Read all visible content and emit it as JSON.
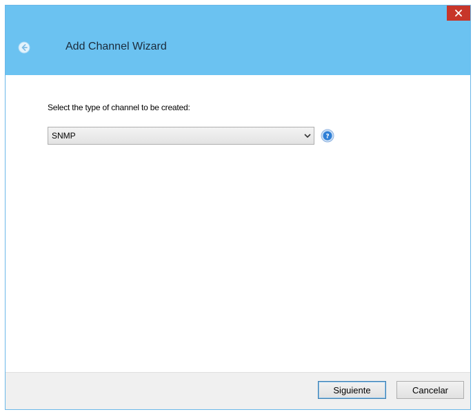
{
  "window": {
    "title": "Add Channel Wizard"
  },
  "header": {
    "close_icon": "close-icon",
    "back_icon": "back-arrow-icon"
  },
  "content": {
    "prompt": "Select the type of channel to be created:",
    "channel_type": {
      "selected": "SNMP"
    },
    "help_icon": "help-icon"
  },
  "footer": {
    "next_label": "Siguiente",
    "cancel_label": "Cancelar"
  },
  "colors": {
    "header_bg": "#6bc2f1",
    "close_bg": "#c7362a",
    "help_blue": "#2f7fd6",
    "footer_bg": "#f0f0f0"
  }
}
